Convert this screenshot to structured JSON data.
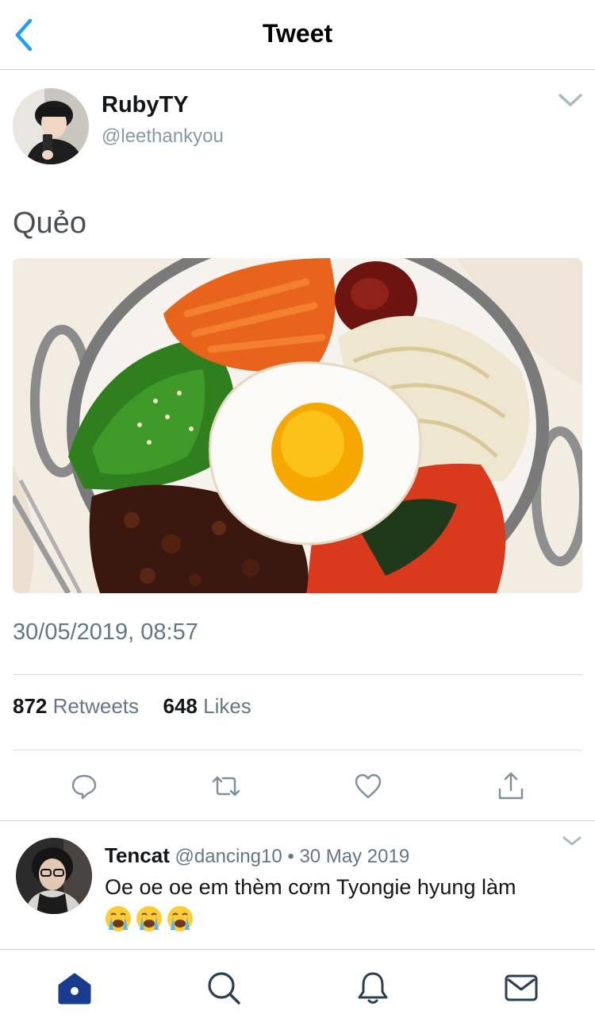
{
  "header": {
    "title": "Tweet"
  },
  "tweet": {
    "author_name": "RubyTY",
    "author_handle": "@leethankyou",
    "text": "Quẻo",
    "image_alt": "Bibimbap bowl with fried egg, carrots, spinach, bean sprouts, kimchi, beef and gochujang",
    "timestamp": "30/05/2019, 08:57",
    "retweets_count": "872",
    "retweets_label": "Retweets",
    "likes_count": "648",
    "likes_label": "Likes"
  },
  "actions": [
    {
      "icon": "reply-icon"
    },
    {
      "icon": "retweet-icon"
    },
    {
      "icon": "like-icon"
    },
    {
      "icon": "share-icon"
    }
  ],
  "reply": {
    "name": "Tencat",
    "handle": "@dancing10",
    "separator": "•",
    "date": "30 May 2019",
    "text": "Oe oe oe em thèm cơm Tyongie hyung làm",
    "emojis": [
      "loudly-crying-face",
      "loudly-crying-face",
      "loudly-crying-face"
    ]
  },
  "tabbar": [
    {
      "icon": "home-icon",
      "active": true
    },
    {
      "icon": "search-icon",
      "active": false
    },
    {
      "icon": "notifications-icon",
      "active": false
    },
    {
      "icon": "messages-icon",
      "active": false
    }
  ],
  "colors": {
    "accent": "#1da1f2",
    "tab_active": "#1b3b8f",
    "tab_inactive": "#2d3e50",
    "secondary_text": "#657786",
    "icon_gray": "#7e8f9c"
  }
}
